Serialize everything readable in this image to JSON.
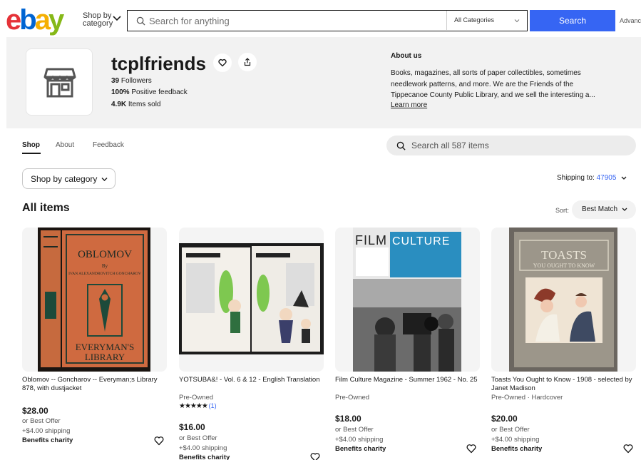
{
  "header": {
    "logo": {
      "e": "e",
      "b": "b",
      "a": "a",
      "y": "y"
    },
    "shop_by_line1": "Shop by",
    "shop_by_line2": "category",
    "search_placeholder": "Search for anything",
    "category_select": "All Categories",
    "search_button": "Search",
    "advanced_link": "Advanced"
  },
  "store": {
    "name": "tcplfriends",
    "followers_count": "39",
    "followers_label": "Followers",
    "feedback_pct": "100%",
    "feedback_label": "Positive feedback",
    "sold_count": "4.9K",
    "sold_label": "Items sold",
    "about_title": "About us",
    "about_text": "Books, magazines, all sorts of paper collectibles, sometimes needlework patterns, and more. We are the Friends of the Tippecanoe County Public Library, and we sell the interesting a...",
    "learn_more": "Learn more"
  },
  "tabs": [
    {
      "label": "Shop",
      "active": true
    },
    {
      "label": "About",
      "active": false
    },
    {
      "label": "Feedback",
      "active": false
    }
  ],
  "store_search_placeholder": "Search all 587 items",
  "controls": {
    "shop_by_category": "Shop by category",
    "shipping_label": "Shipping to:",
    "shipping_zip": "47905",
    "section_title": "All items",
    "sort_label": "Sort:",
    "sort_value": "Best Match"
  },
  "items": [
    {
      "title": "Oblomov -- Goncharov -- Everyman;s Library 878, with dustjacket",
      "condition": "",
      "price": "$28.00",
      "offer": "or Best Offer",
      "shipping": "+$4.00 shipping",
      "charity": "Benefits charity",
      "image_text": {
        "top": "OBLOMOV",
        "by": "By",
        "author": "IVAN ALEXANDROVITCH GONCHAROV",
        "bottom1": "EVERYMAN'S",
        "bottom2": "LIBRARY"
      }
    },
    {
      "title": "YOTSUBA&! - Vol. 6 & 12 - English Translation",
      "condition": "Pre-Owned",
      "rating": "★★★★★",
      "rating_count": "(1)",
      "price": "$16.00",
      "offer": "or Best Offer",
      "shipping": "+$4.00 shipping",
      "charity": "Benefits charity"
    },
    {
      "title": "Film Culture Magazine - Summer 1962 - No. 25",
      "condition": "Pre-Owned",
      "price": "$18.00",
      "offer": "or Best Offer",
      "shipping": "+$4.00 shipping",
      "charity": "Benefits charity",
      "image_text": {
        "left": "FILM",
        "right": "CULTURE"
      }
    },
    {
      "title": "Toasts You Ought to Know - 1908 - selected by Janet Madison",
      "condition": "Pre-Owned · Hardcover",
      "price": "$20.00",
      "offer": "or Best Offer",
      "shipping": "+$4.00 shipping",
      "charity": "Benefits charity",
      "image_text": {
        "title1": "TOASTS",
        "title2": "YOU OUGHT TO KNOW"
      }
    }
  ],
  "colors": {
    "accent": "#3665f3",
    "banner_bg": "#f2f2f2"
  }
}
